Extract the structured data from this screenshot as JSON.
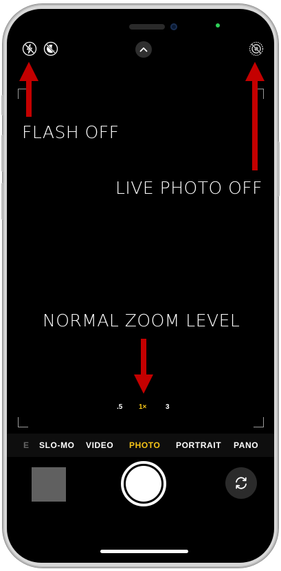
{
  "top_controls": {
    "flash_icon": "flash-off-icon",
    "night_icon": "night-mode-off-icon",
    "chevron_icon": "chevron-up-icon",
    "live_icon": "live-photo-off-icon"
  },
  "annotations": {
    "flash": "FLASH OFF",
    "live_photo": "LIVE PHOTO OFF",
    "zoom": "NORMAL ZOOM LEVEL"
  },
  "zoom": {
    "options": [
      ".5",
      "1×",
      "3"
    ],
    "selected": "1×"
  },
  "modes": {
    "items": [
      "E",
      "SLO-MO",
      "VIDEO",
      "PHOTO",
      "PORTRAIT",
      "PANO"
    ],
    "selected": "PHOTO"
  },
  "colors": {
    "accent": "#f5c518",
    "arrow": "#c40000"
  },
  "bottom": {
    "thumbnail_icon": "last-photo-thumbnail",
    "shutter_icon": "shutter-icon",
    "flip_icon": "camera-flip-icon"
  }
}
